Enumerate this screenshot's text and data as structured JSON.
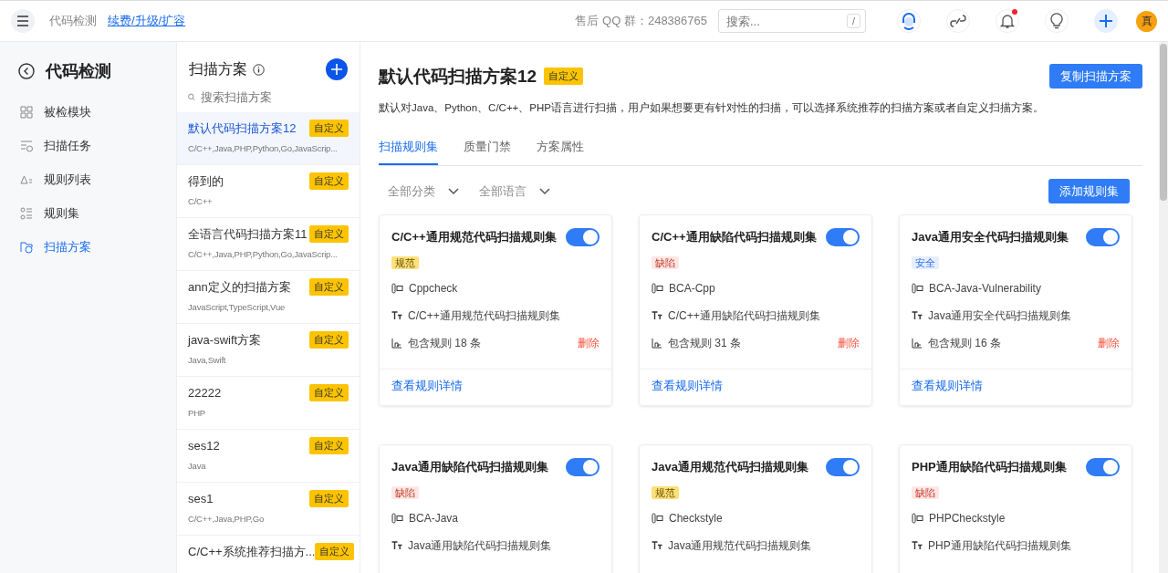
{
  "topbar": {
    "app_name": "代码检测",
    "renew_link": "续费/升级/扩容",
    "qq_group": "售后 QQ 群：248386765",
    "search": {
      "placeholder": "搜索...",
      "shortcut": "/"
    },
    "avatar": "真"
  },
  "sidebar": {
    "title": "代码检测",
    "items": [
      {
        "label": "被检模块",
        "selected": false
      },
      {
        "label": "扫描任务",
        "selected": false
      },
      {
        "label": "规则列表",
        "selected": false
      },
      {
        "label": "规则集",
        "selected": false
      },
      {
        "label": "扫描方案",
        "selected": true
      }
    ]
  },
  "plans": {
    "title": "扫描方案",
    "search": {
      "placeholder": "搜索扫描方案"
    },
    "items": [
      {
        "name": "默认代码扫描方案12",
        "tag": "自定义",
        "languages": "C/C++,Java,PHP,Python,Go,JavaScrip...",
        "selected": true
      },
      {
        "name": "得到的",
        "tag": "自定义",
        "languages": "C/C++",
        "selected": false
      },
      {
        "name": "全语言代码扫描方案11",
        "tag": "自定义",
        "languages": "C/C++,Java,PHP,Python,Go,JavaScrip...",
        "selected": false
      },
      {
        "name": "ann定义的扫描方案",
        "tag": "自定义",
        "languages": "JavaScript,TypeScript,Vue",
        "selected": false
      },
      {
        "name": "java-swift方案",
        "tag": "自定义",
        "languages": "Java,Swift",
        "selected": false
      },
      {
        "name": "22222",
        "tag": "自定义",
        "languages": "PHP",
        "selected": false
      },
      {
        "name": "ses12",
        "tag": "自定义",
        "languages": "Java",
        "selected": false
      },
      {
        "name": "ses1",
        "tag": "自定义",
        "languages": "C/C++,Java,PHP,Go",
        "selected": false
      },
      {
        "name": "C/C++系统推荐扫描方...",
        "tag": "自定义",
        "selected": false
      }
    ]
  },
  "detail": {
    "title": "默认代码扫描方案12",
    "tag": "自定义",
    "copy_button": "复制扫描方案",
    "description": "默认对Java、Python、C/C++、PHP语言进行扫描，用户如果想要更有针对性的扫描，可以选择系统推荐的扫描方案或者自定义扫描方案。",
    "tabs": [
      {
        "label": "扫描规则集",
        "selected": true
      },
      {
        "label": "质量门禁",
        "selected": false
      },
      {
        "label": "方案属性",
        "selected": false
      }
    ],
    "filters": [
      "全部分类",
      "全部语言"
    ],
    "add_button": "添加规则集",
    "rulesets": [
      {
        "title": "C/C++通用规范代码扫描规则集",
        "on": true,
        "tag": "规范",
        "kind": "norm",
        "tool": "Cppcheck",
        "name": "C/C++通用规范代码扫描规则集",
        "count": "包含规则 18 条",
        "delete": "删除",
        "details": "查看规则详情"
      },
      {
        "title": "C/C++通用缺陷代码扫描规则集",
        "on": true,
        "tag": "缺陷",
        "kind": "defect",
        "tool": "BCA-Cpp",
        "name": "C/C++通用缺陷代码扫描规则集",
        "count": "包含规则 31 条",
        "delete": "删除",
        "details": "查看规则详情"
      },
      {
        "title": "Java通用安全代码扫描规则集",
        "on": true,
        "tag": "安全",
        "kind": "security",
        "tool": "BCA-Java-Vulnerability",
        "name": "Java通用安全代码扫描规则集",
        "count": "包含规则 16 条",
        "delete": "删除",
        "details": "查看规则详情"
      },
      {
        "title": "Java通用缺陷代码扫描规则集",
        "on": true,
        "tag": "缺陷",
        "kind": "defect",
        "tool": "BCA-Java",
        "name": "Java通用缺陷代码扫描规则集"
      },
      {
        "title": "Java通用规范代码扫描规则集",
        "on": true,
        "tag": "规范",
        "kind": "norm",
        "tool": "Checkstyle",
        "name": "Java通用规范代码扫描规则集"
      },
      {
        "title": "PHP通用缺陷代码扫描规则集",
        "on": true,
        "tag": "缺陷",
        "kind": "defect",
        "tool": "PHPCheckstyle",
        "name": "PHP通用缺陷代码扫描规则集"
      }
    ]
  }
}
